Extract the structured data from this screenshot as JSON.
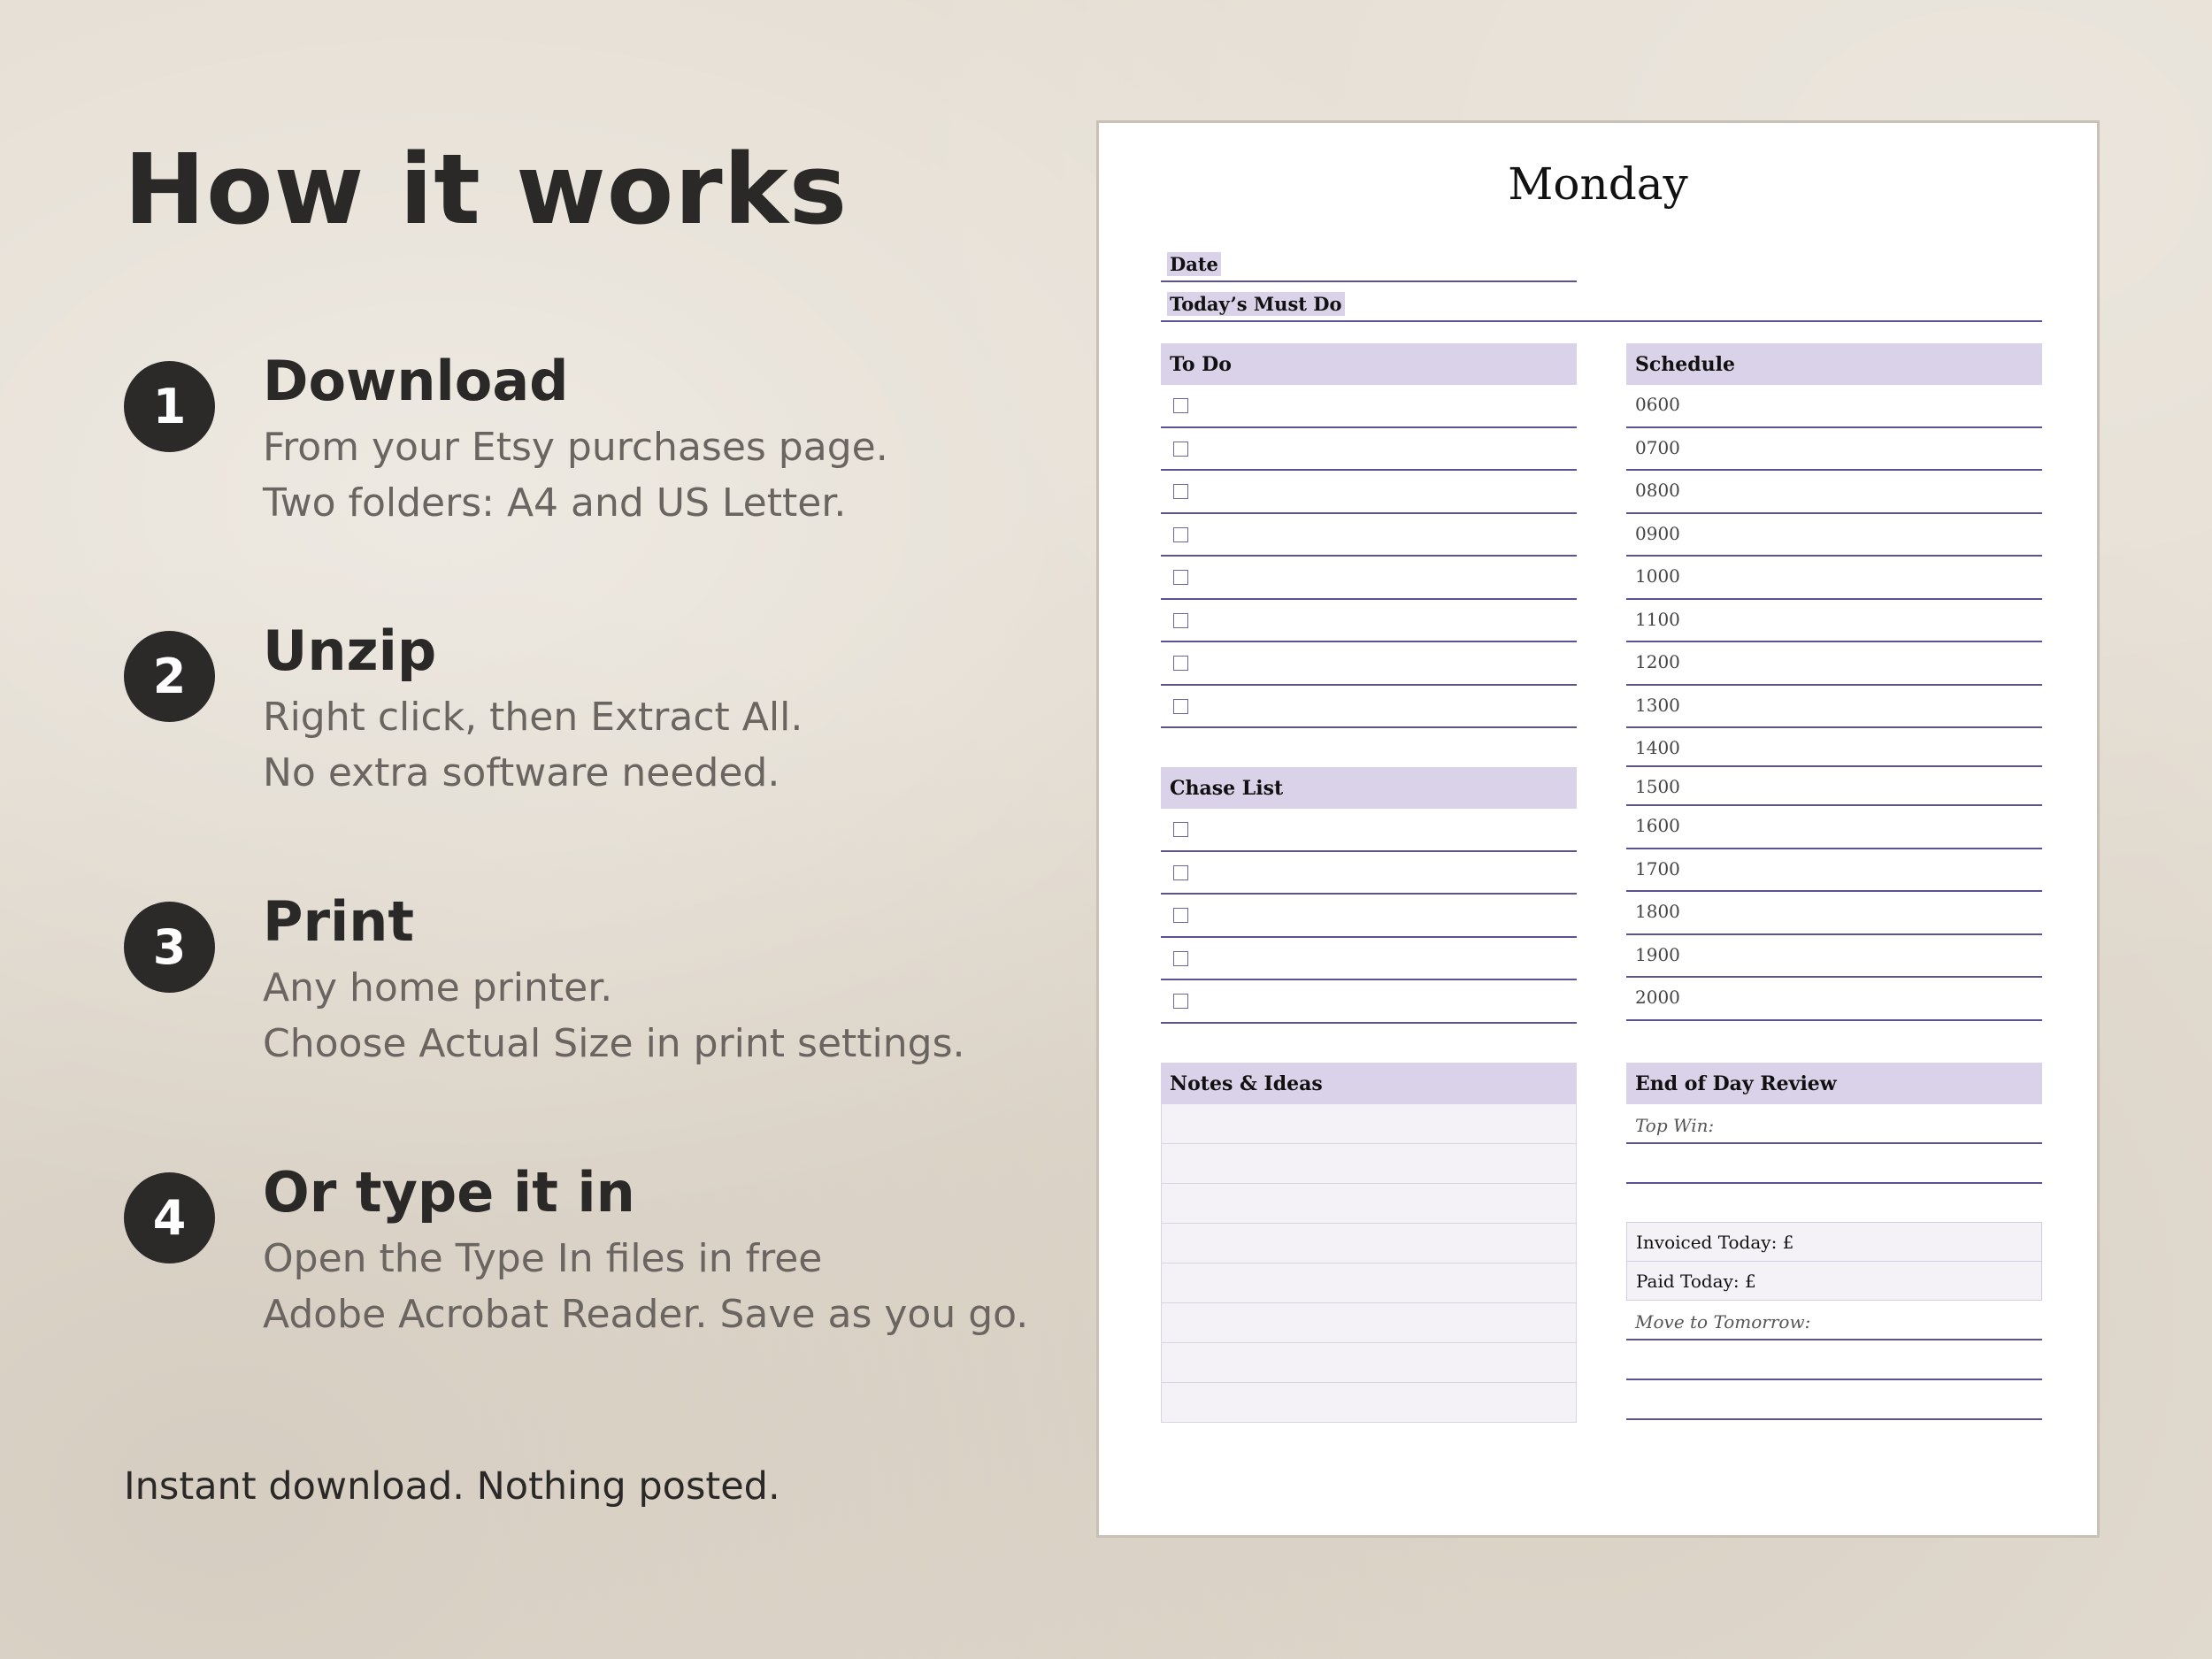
{
  "left": {
    "title": "How it works",
    "steps": [
      {
        "number": "1",
        "title": "Download",
        "line1": "From your Etsy purchases page.",
        "line2": "Two folders: A4 and US Letter."
      },
      {
        "number": "2",
        "title": "Unzip",
        "line1": "Right click, then Extract All.",
        "line2": "No extra software needed."
      },
      {
        "number": "3",
        "title": "Print",
        "line1": "Any home printer.",
        "line2": "Choose Actual Size in print settings."
      },
      {
        "number": "4",
        "title": "Or type it in",
        "line1": "Open the Type In files in free",
        "line2": "Adobe Acrobat Reader. Save as you go."
      }
    ],
    "footer": "Instant download. Nothing posted."
  },
  "planner": {
    "day": "Monday",
    "date_label": "Date",
    "must_do_label": "Today’s Must Do",
    "todo": {
      "title": "To Do"
    },
    "chase": {
      "title": "Chase List"
    },
    "schedule": {
      "title": "Schedule",
      "times": [
        "0600",
        "0700",
        "0800",
        "0900",
        "1000",
        "1100",
        "1200",
        "1300",
        "1400",
        "1500",
        "1600",
        "1700",
        "1800",
        "1900",
        "2000"
      ]
    },
    "notes": {
      "title": "Notes & Ideas"
    },
    "review": {
      "title": "End of Day Review",
      "top_win": "Top Win:",
      "invoiced": "Invoiced Today: £",
      "paid": "Paid Today: £",
      "move": "Move to Tomorrow:"
    }
  },
  "colors": {
    "accent_lavender": "#d9d2e8",
    "rule_purple": "#5b5296",
    "dark": "#2a2927",
    "muted_text": "#6a6560",
    "background": "#e4ddd2"
  }
}
